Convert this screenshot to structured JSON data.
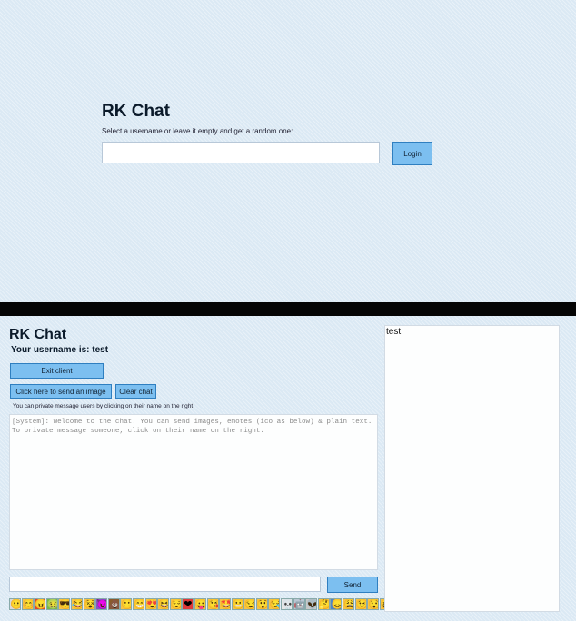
{
  "login": {
    "title": "RK Chat",
    "hint": "Select a username or leave it empty and get a random one:",
    "username_value": "",
    "login_label": "Login"
  },
  "chat": {
    "title": "RK Chat",
    "username_line": "Your username is: test",
    "exit_label": "Exit client",
    "send_image_label": "Click here to send an image",
    "clear_label": "Clear chat",
    "pm_hint": "You can private message users by clicking on their name on the right",
    "log_text": "[System]: Welcome to the chat. You can send images, emotes (ico as below) & plain text. To private message someone, click on their name on the right.",
    "message_value": "",
    "send_label": "Send"
  },
  "users": [
    "test"
  ],
  "emotes": [
    {
      "icon": "neutral-face-icon",
      "glyph": "😐",
      "color": "#d9d9d9"
    },
    {
      "icon": "smiling-face-icon",
      "glyph": "😊",
      "color": "#f6c445"
    },
    {
      "icon": "angry-face-icon",
      "glyph": "😠",
      "color": "#e0452b"
    },
    {
      "icon": "nauseated-face-icon",
      "glyph": "🤢",
      "color": "#74b94a"
    },
    {
      "icon": "sunglasses-face-icon",
      "glyph": "😎",
      "color": "#f6c445"
    },
    {
      "icon": "crying-laughing-face-icon",
      "glyph": "😂",
      "color": "#f6c445"
    },
    {
      "icon": "dizzy-face-icon",
      "glyph": "😵",
      "color": "#f6c445"
    },
    {
      "icon": "devil-face-icon",
      "glyph": "😈",
      "color": "#8a4fc7"
    },
    {
      "icon": "poop-icon",
      "glyph": "💩",
      "color": "#8a5a2b"
    },
    {
      "icon": "slight-smile-face-icon",
      "glyph": "🙂",
      "color": "#f6c445"
    },
    {
      "icon": "grinning-face-icon",
      "glyph": "😁",
      "color": "#f6c445"
    },
    {
      "icon": "heart-eyes-face-icon",
      "glyph": "😍",
      "color": "#f6c445"
    },
    {
      "icon": "laughing-face-icon",
      "glyph": "😆",
      "color": "#f6c445"
    },
    {
      "icon": "blush-face-icon",
      "glyph": "😌",
      "color": "#f6c445"
    },
    {
      "icon": "heart-icon",
      "glyph": "❤",
      "color": "#e03a3a"
    },
    {
      "icon": "tongue-face-icon",
      "glyph": "😛",
      "color": "#f6c445"
    },
    {
      "icon": "kissing-face-icon",
      "glyph": "😘",
      "color": "#f6c445"
    },
    {
      "icon": "star-struck-face-icon",
      "glyph": "🤩",
      "color": "#f6c445"
    },
    {
      "icon": "grimacing-face-icon",
      "glyph": "😬",
      "color": "#f6c445"
    },
    {
      "icon": "smirk-face-icon",
      "glyph": "😏",
      "color": "#f6c445"
    },
    {
      "icon": "astonished-face-icon",
      "glyph": "😲",
      "color": "#f6c445"
    },
    {
      "icon": "sleepy-face-icon",
      "glyph": "😪",
      "color": "#f6c445"
    },
    {
      "icon": "skull-icon",
      "glyph": "💀",
      "color": "#e6e6e6"
    },
    {
      "icon": "robot-face-icon",
      "glyph": "🤖",
      "color": "#b9c6d2"
    },
    {
      "icon": "alien-icon",
      "glyph": "👽",
      "color": "#c8c8c8"
    },
    {
      "icon": "thinking-face-icon",
      "glyph": "🤔",
      "color": "#f6c445"
    },
    {
      "icon": "disappointed-face-icon",
      "glyph": "😞",
      "color": "#4f86c6"
    },
    {
      "icon": "weary-face-icon",
      "glyph": "😩",
      "color": "#f6c445"
    },
    {
      "icon": "wink-face-icon",
      "glyph": "😉",
      "color": "#f6c445"
    },
    {
      "icon": "hushed-face-icon",
      "glyph": "😯",
      "color": "#f6c445"
    },
    {
      "icon": "squinting-tongue-face-icon",
      "glyph": "😝",
      "color": "#f6c445"
    }
  ]
}
